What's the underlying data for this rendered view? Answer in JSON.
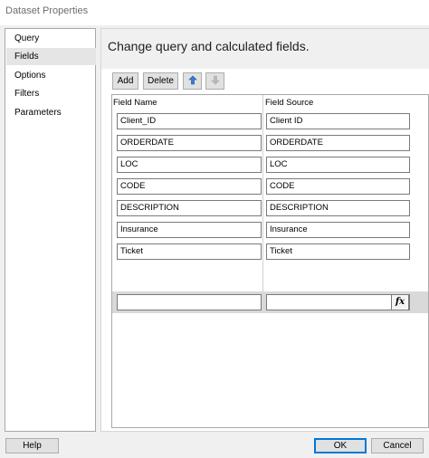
{
  "window": {
    "title": "Dataset Properties"
  },
  "sidebar": {
    "items": [
      {
        "label": "Query"
      },
      {
        "label": "Fields"
      },
      {
        "label": "Options"
      },
      {
        "label": "Filters"
      },
      {
        "label": "Parameters"
      }
    ],
    "selected": "Fields"
  },
  "main": {
    "heading": "Change query and calculated fields.",
    "toolbar": {
      "add_label": "Add",
      "delete_label": "Delete",
      "move_up_icon": "arrow-up-icon",
      "move_down_icon": "arrow-down-icon"
    },
    "grid": {
      "columns": [
        "Field Name",
        "Field Source"
      ],
      "rows": [
        {
          "name": "Client_ID",
          "source": "Client ID"
        },
        {
          "name": "ORDERDATE",
          "source": "ORDERDATE"
        },
        {
          "name": "LOC",
          "source": "LOC"
        },
        {
          "name": "CODE",
          "source": "CODE"
        },
        {
          "name": "DESCRIPTION",
          "source": "DESCRIPTION"
        },
        {
          "name": "Insurance",
          "source": "Insurance"
        },
        {
          "name": "Ticket",
          "source": "Ticket"
        }
      ],
      "new_row": {
        "name": "",
        "source": ""
      },
      "fx_label": "fx"
    }
  },
  "footer": {
    "help_label": "Help",
    "ok_label": "OK",
    "cancel_label": "Cancel"
  },
  "colors": {
    "accent": "#0078d7",
    "selected_item_bg": "#e5e5e5",
    "button_bg": "#e1e1e1"
  }
}
